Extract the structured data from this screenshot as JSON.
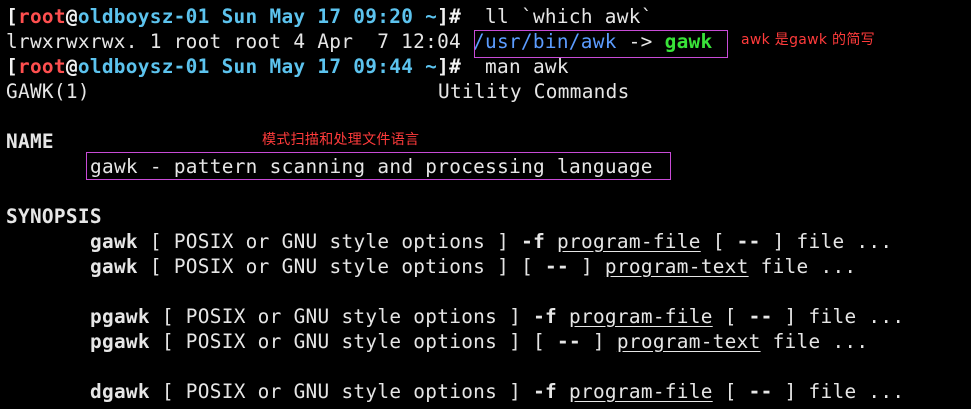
{
  "prompt1": {
    "open": "[",
    "user": "root",
    "at": "@",
    "host": "oldboysz-01",
    "date": "Sun May 17 09:20",
    "path": "~",
    "close": "]#",
    "command": "ll `which awk`"
  },
  "ls_output": {
    "prefix": "lrwxrwxrwx. 1 root root 4 Apr  7 12:04 ",
    "target": "/usr/bin/awk",
    "arrow": " -> ",
    "link": "gawk"
  },
  "prompt2": {
    "open": "[",
    "user": "root",
    "at": "@",
    "host": "oldboysz-01",
    "date": "Sun May 17 09:44",
    "path": "~",
    "close": "]#",
    "command": "man awk"
  },
  "man": {
    "header_left": "GAWK(1)",
    "header_center": "Utility Commands",
    "name_heading": "NAME",
    "name_desc": "gawk - pattern scanning and processing language",
    "synopsis_heading": "SYNOPSIS",
    "synopsis": [
      {
        "cmd": "gawk",
        "a": " [ POSIX or GNU style options ] ",
        "flag": "-f",
        "sp": " ",
        "arg": "program-file",
        "b": " [ ",
        "dd": "--",
        "c": " ] file ..."
      },
      {
        "cmd": "gawk",
        "a": " [ POSIX or GNU style options ] [ ",
        "dd": "--",
        "b": " ] ",
        "arg": "program-text",
        "c": " file ..."
      },
      {
        "cmd": "pgawk",
        "a": " [ POSIX or GNU style options ] ",
        "flag": "-f",
        "sp": " ",
        "arg": "program-file",
        "b": " [ ",
        "dd": "--",
        "c": " ] file ..."
      },
      {
        "cmd": "pgawk",
        "a": " [ POSIX or GNU style options ] [ ",
        "dd": "--",
        "b": " ] ",
        "arg": "program-text",
        "c": " file ..."
      },
      {
        "cmd": "dgawk",
        "a": " [ POSIX or GNU style options ] ",
        "flag": "-f",
        "sp": " ",
        "arg": "program-file",
        "b": " [ ",
        "dd": "--",
        "c": " ] file ..."
      }
    ]
  },
  "annotations": {
    "awk_note": "awk 是gawk 的简写",
    "name_note": "模式扫描和处理文件语言"
  },
  "colors": {
    "background": "#000000",
    "prompt_user": "#ff4f4f",
    "prompt_host": "#5cc3ee",
    "symlink_target": "#5c9cff",
    "symlink_name": "#39e339",
    "annotation": "#ff3b3b",
    "highlight_box": "#c84bd6"
  }
}
